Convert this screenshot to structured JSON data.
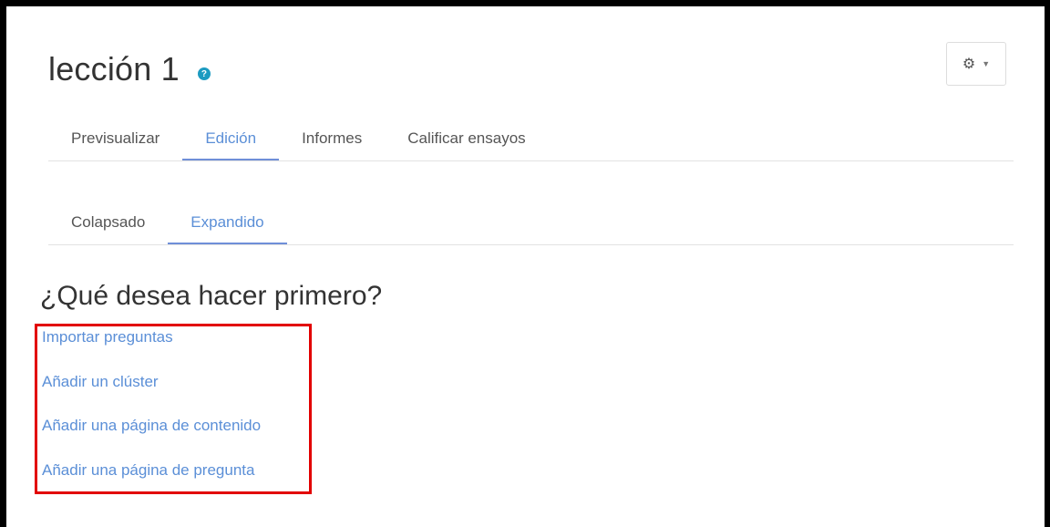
{
  "header": {
    "title": "lección 1",
    "help_icon": "question-circle-icon",
    "help_glyph": "?",
    "gear_icon": "gear-icon",
    "gear_glyph": "⚙",
    "caret_glyph": "▼"
  },
  "primary_tabs": [
    {
      "label": "Previsualizar",
      "active": false
    },
    {
      "label": "Edición",
      "active": true
    },
    {
      "label": "Informes",
      "active": false
    },
    {
      "label": "Calificar ensayos",
      "active": false
    }
  ],
  "secondary_tabs": [
    {
      "label": "Colapsado",
      "active": false
    },
    {
      "label": "Expandido",
      "active": true
    }
  ],
  "main": {
    "question": "¿Qué desea hacer primero?",
    "links": [
      "Importar preguntas",
      "Añadir un clúster",
      "Añadir una página de contenido",
      "Añadir una página de pregunta"
    ]
  },
  "colors": {
    "link": "#5b8fd7",
    "active_tab_underline": "#6f8fd8",
    "highlight_box": "#e20000",
    "help_icon": "#1d9bc1"
  }
}
